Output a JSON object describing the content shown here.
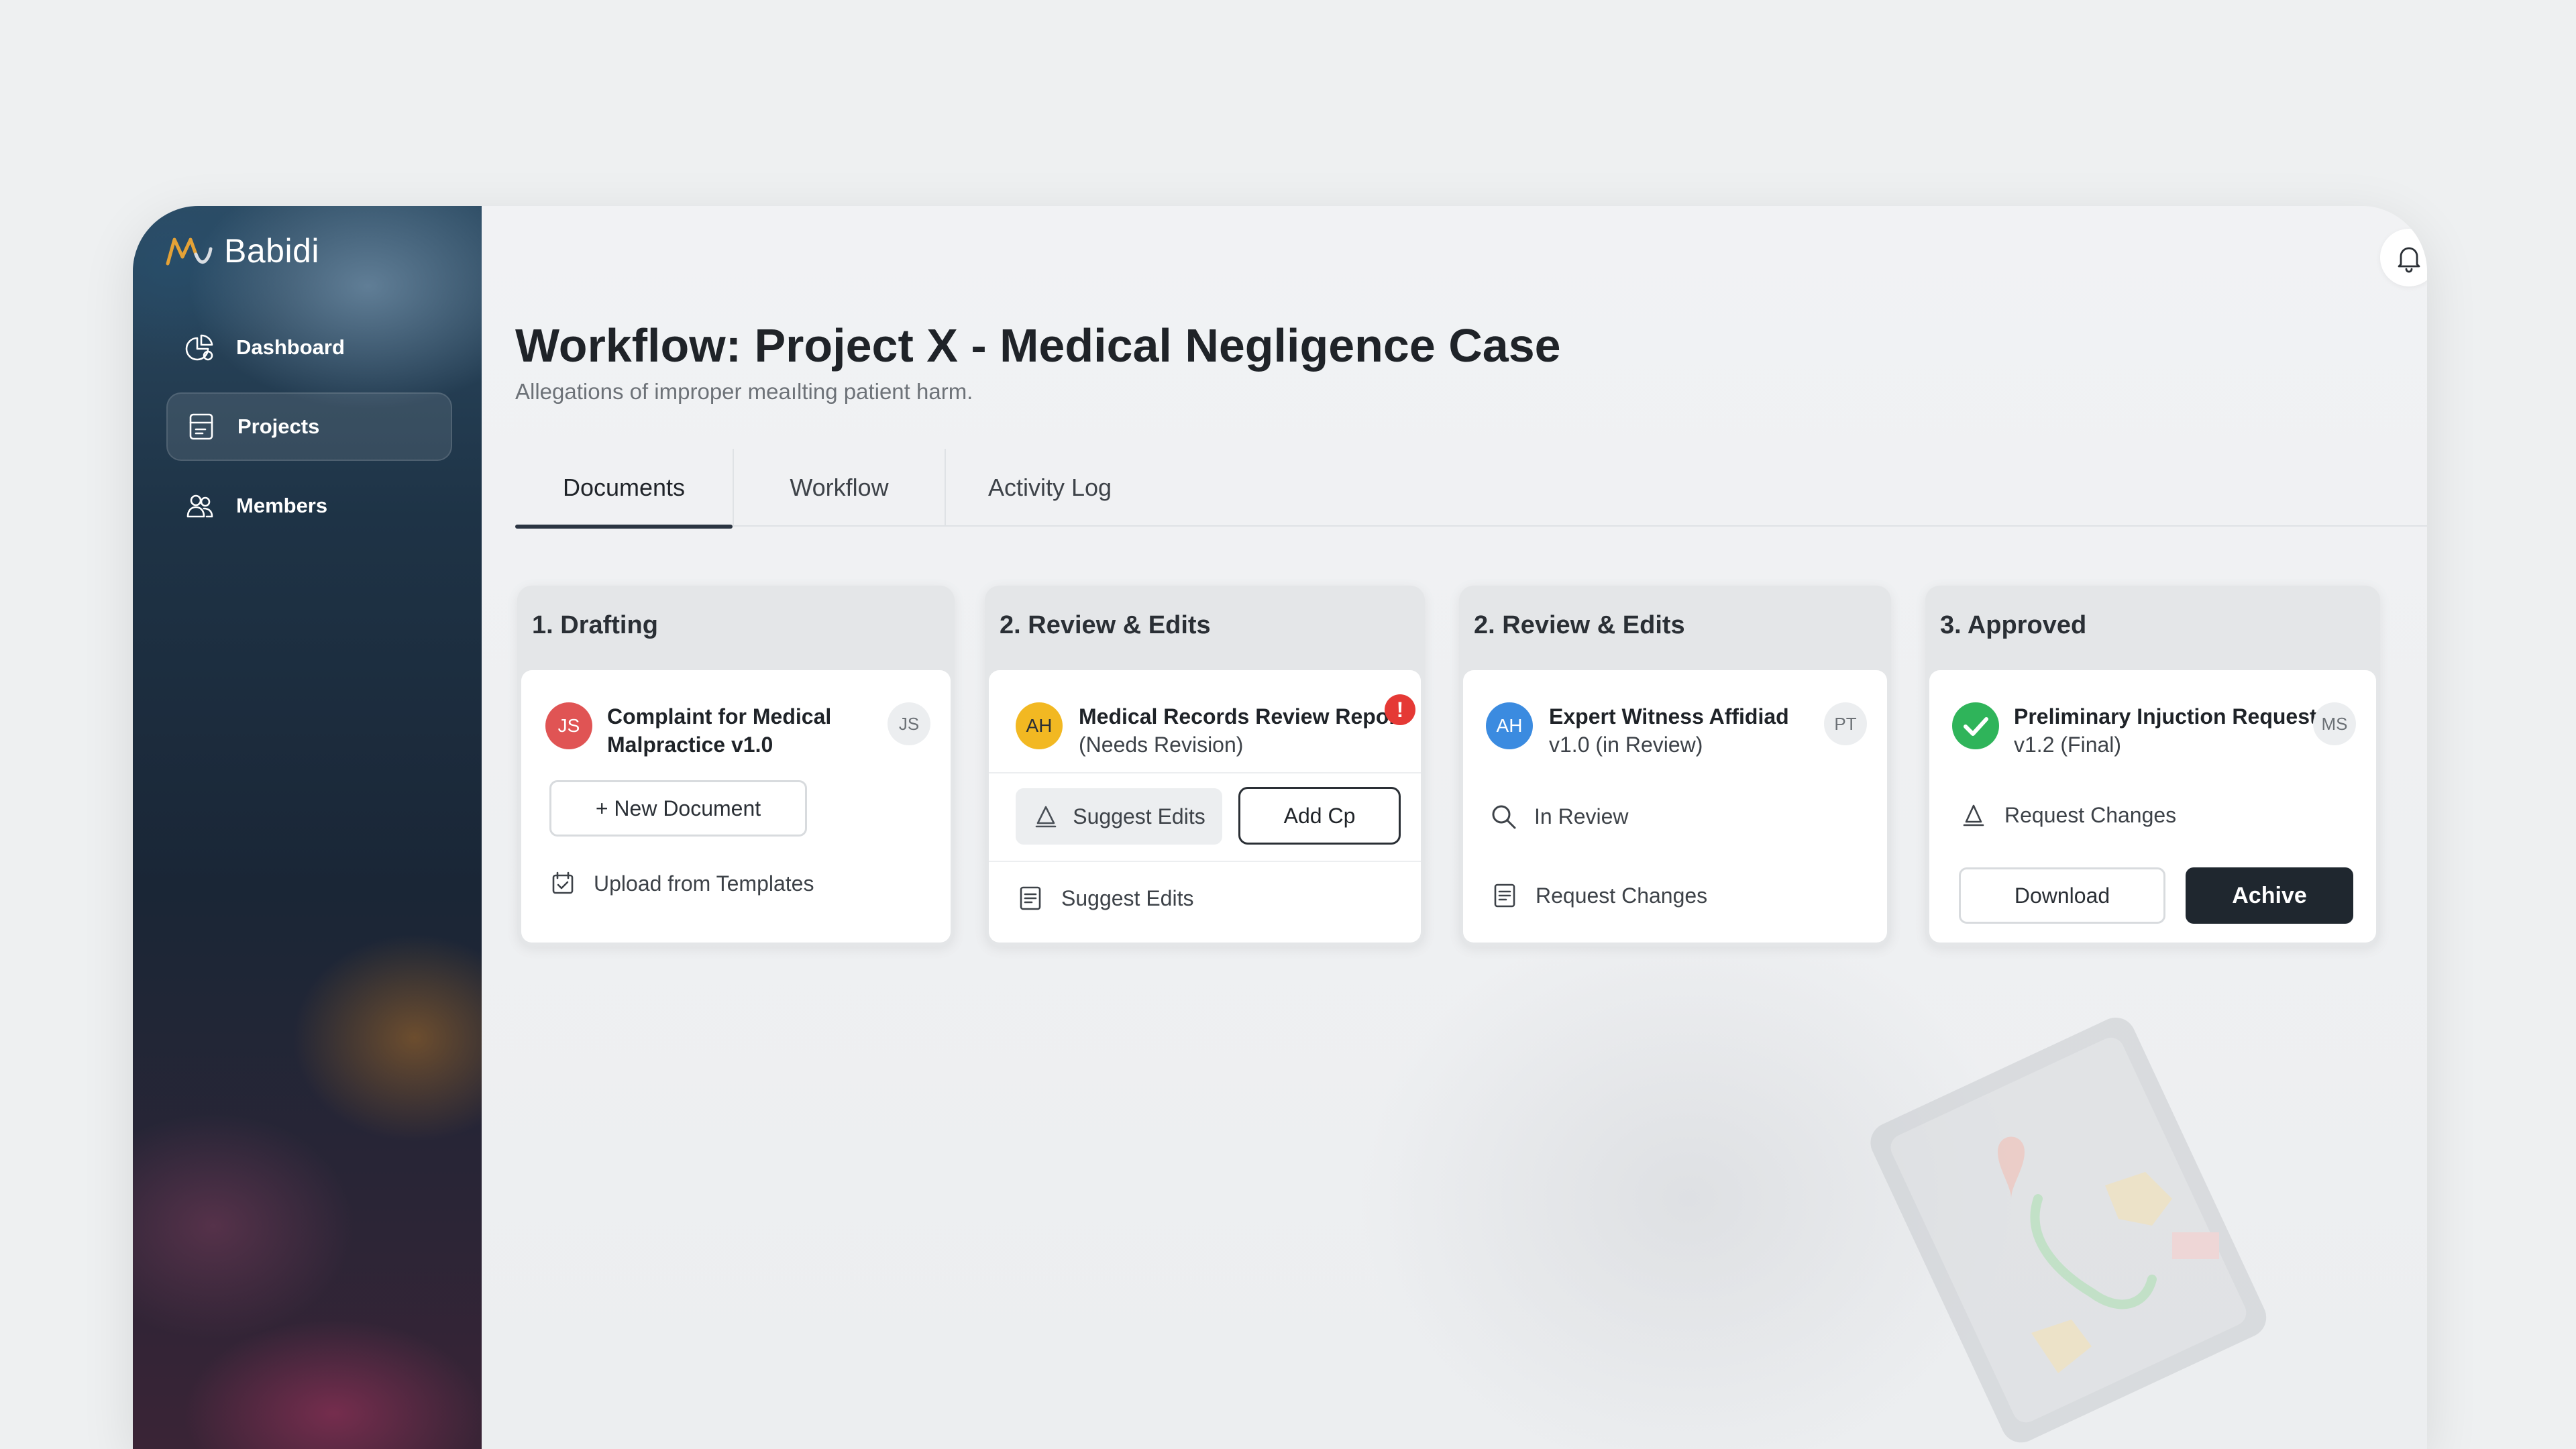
{
  "brand": {
    "name": "Babidi",
    "accent": "#e5a236"
  },
  "sidebar": {
    "items": [
      {
        "label": "Dashboard",
        "icon": "dashboard-icon",
        "active": false
      },
      {
        "label": "Projects",
        "icon": "folder-icon",
        "active": true
      },
      {
        "label": "Members",
        "icon": "members-icon",
        "active": false
      }
    ]
  },
  "header": {
    "title": "Workflow: Project X - Medical Negligence Case",
    "subtitle": "Allegations of improper meaılting patient harm."
  },
  "tabs": [
    {
      "label": "Documents",
      "active": true
    },
    {
      "label": "Workflow",
      "active": false
    },
    {
      "label": "Activity Log",
      "active": false
    }
  ],
  "columns": [
    {
      "title": "1. Drafting",
      "doc": {
        "initials": "JS",
        "badge_color": "#e05454",
        "title_line1": "Complaint for Medical",
        "title_line2": "Malpractice v1.0",
        "assignee": "JS"
      },
      "new_document_label": "+ New Document",
      "upload_label": "Upload from Templates"
    },
    {
      "title": "2. Review & Edits",
      "doc": {
        "initials": "AH",
        "badge_color": "#f2b822",
        "title_line1": "Medical Records Review Repor",
        "title_line2": "(Needs Revision)",
        "alert": "!"
      },
      "suggest_button_label": "Suggest Edits",
      "add_button_label": "Add Cp",
      "suggest_row_label": "Suggest Edits"
    },
    {
      "title": "2. Review & Edits",
      "doc": {
        "initials": "AH",
        "badge_color": "#3b8be0",
        "title_line1": "Expert Witness Affidiad",
        "title_line2": "v1.0 (in Review)",
        "assignee": "PT"
      },
      "in_review_label": "In Review",
      "request_changes_label": "Request Changes"
    },
    {
      "title": "3. Approved",
      "doc": {
        "badge_color": "#2fb45a",
        "title_line1": "Preliminary Injuction Request",
        "title_line2": "v1.2 (Final)",
        "assignee": "MS"
      },
      "request_changes_label": "Request Changes",
      "download_label": "Download",
      "archive_label": "Achive"
    }
  ]
}
